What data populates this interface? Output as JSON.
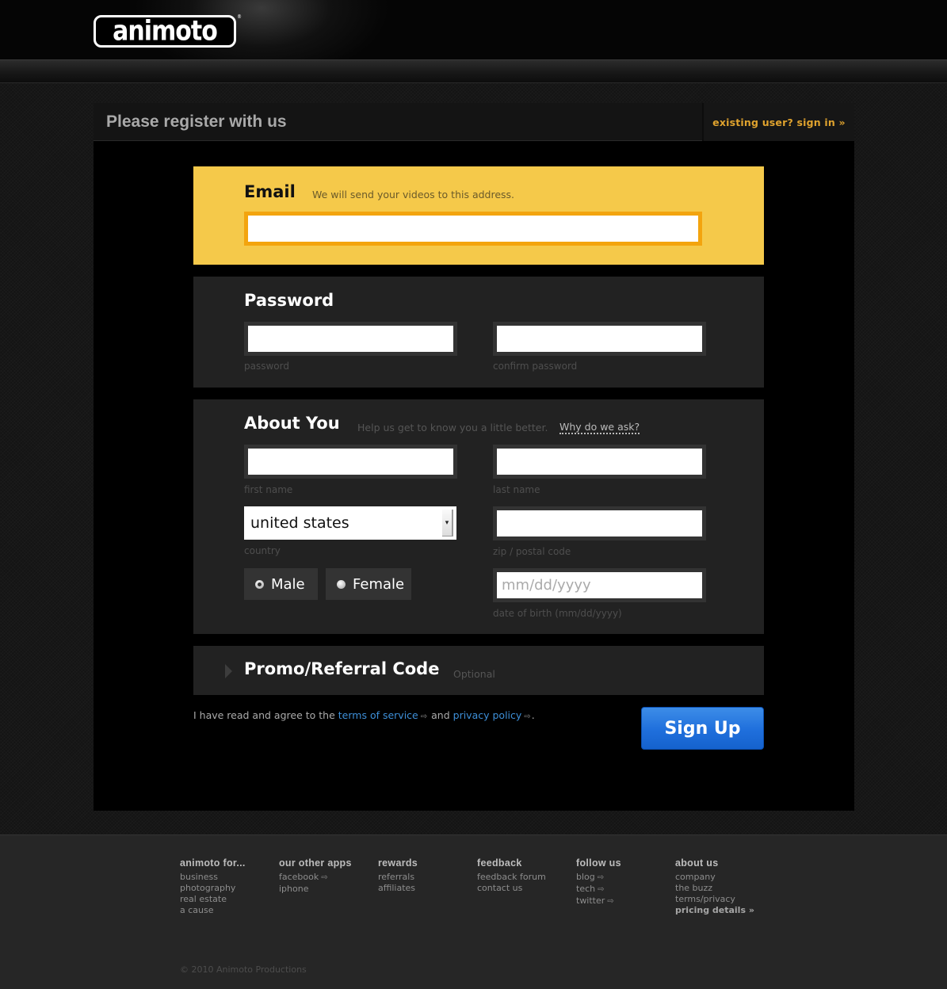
{
  "header": {
    "logo_text": "animoto",
    "logo_reg": "®"
  },
  "panel": {
    "title": "Please register with us",
    "signin_link": "existing user? sign in »"
  },
  "email_section": {
    "title": "Email",
    "hint": "We will send your videos to this address.",
    "value": ""
  },
  "password_section": {
    "title": "Password",
    "password_label": "password",
    "confirm_label": "confirm password",
    "password_value": "",
    "confirm_value": ""
  },
  "about_section": {
    "title": "About You",
    "hint": "Help us get to know you a little better.",
    "why_link": "Why do we ask?",
    "first_name_label": "first name",
    "last_name_label": "last name",
    "country_label": "country",
    "country_value": "united states",
    "zip_label": "zip / postal code",
    "dob_placeholder": "mm/dd/yyyy",
    "dob_label": "date of birth (mm/dd/yyyy)",
    "gender_options": [
      {
        "label": "Male",
        "checked": true
      },
      {
        "label": "Female",
        "checked": false
      }
    ]
  },
  "promo_section": {
    "title": "Promo/Referral Code",
    "optional": "Optional"
  },
  "agreement": {
    "prefix": "I have read and agree to the",
    "terms_link": "terms of service",
    "middle": "and",
    "privacy_link": "privacy policy",
    "suffix": "."
  },
  "signup_button": "Sign Up",
  "icons": {
    "external": "⇨",
    "dropdown": "▾",
    "expand": "triangle-right"
  },
  "footer": {
    "columns": [
      {
        "heading": "animoto for...",
        "links": [
          {
            "label": "business"
          },
          {
            "label": "photography"
          },
          {
            "label": "real estate"
          },
          {
            "label": "a cause"
          }
        ]
      },
      {
        "heading": "our other apps",
        "links": [
          {
            "label": "facebook",
            "external": true
          },
          {
            "label": "iphone"
          }
        ]
      },
      {
        "heading": "rewards",
        "links": [
          {
            "label": "referrals"
          },
          {
            "label": "affiliates"
          }
        ]
      },
      {
        "heading": "feedback",
        "links": [
          {
            "label": "feedback forum"
          },
          {
            "label": "contact us"
          }
        ]
      },
      {
        "heading": "follow us",
        "links": [
          {
            "label": "blog",
            "external": true
          },
          {
            "label": "tech",
            "external": true
          },
          {
            "label": "twitter",
            "external": true
          }
        ]
      },
      {
        "heading": "about us",
        "links": [
          {
            "label": "company"
          },
          {
            "label": "the buzz"
          },
          {
            "label": "terms/privacy"
          },
          {
            "label": "pricing details »",
            "bold": true
          }
        ]
      }
    ],
    "copyright": "© 2010 Animoto Productions"
  },
  "colors": {
    "email_bg": "#f5c94a",
    "email_border": "#f3a40e",
    "link_blue": "#3d8fd8",
    "signin_orange": "#e0a32e",
    "signup_blue": "#1f6fdc"
  }
}
